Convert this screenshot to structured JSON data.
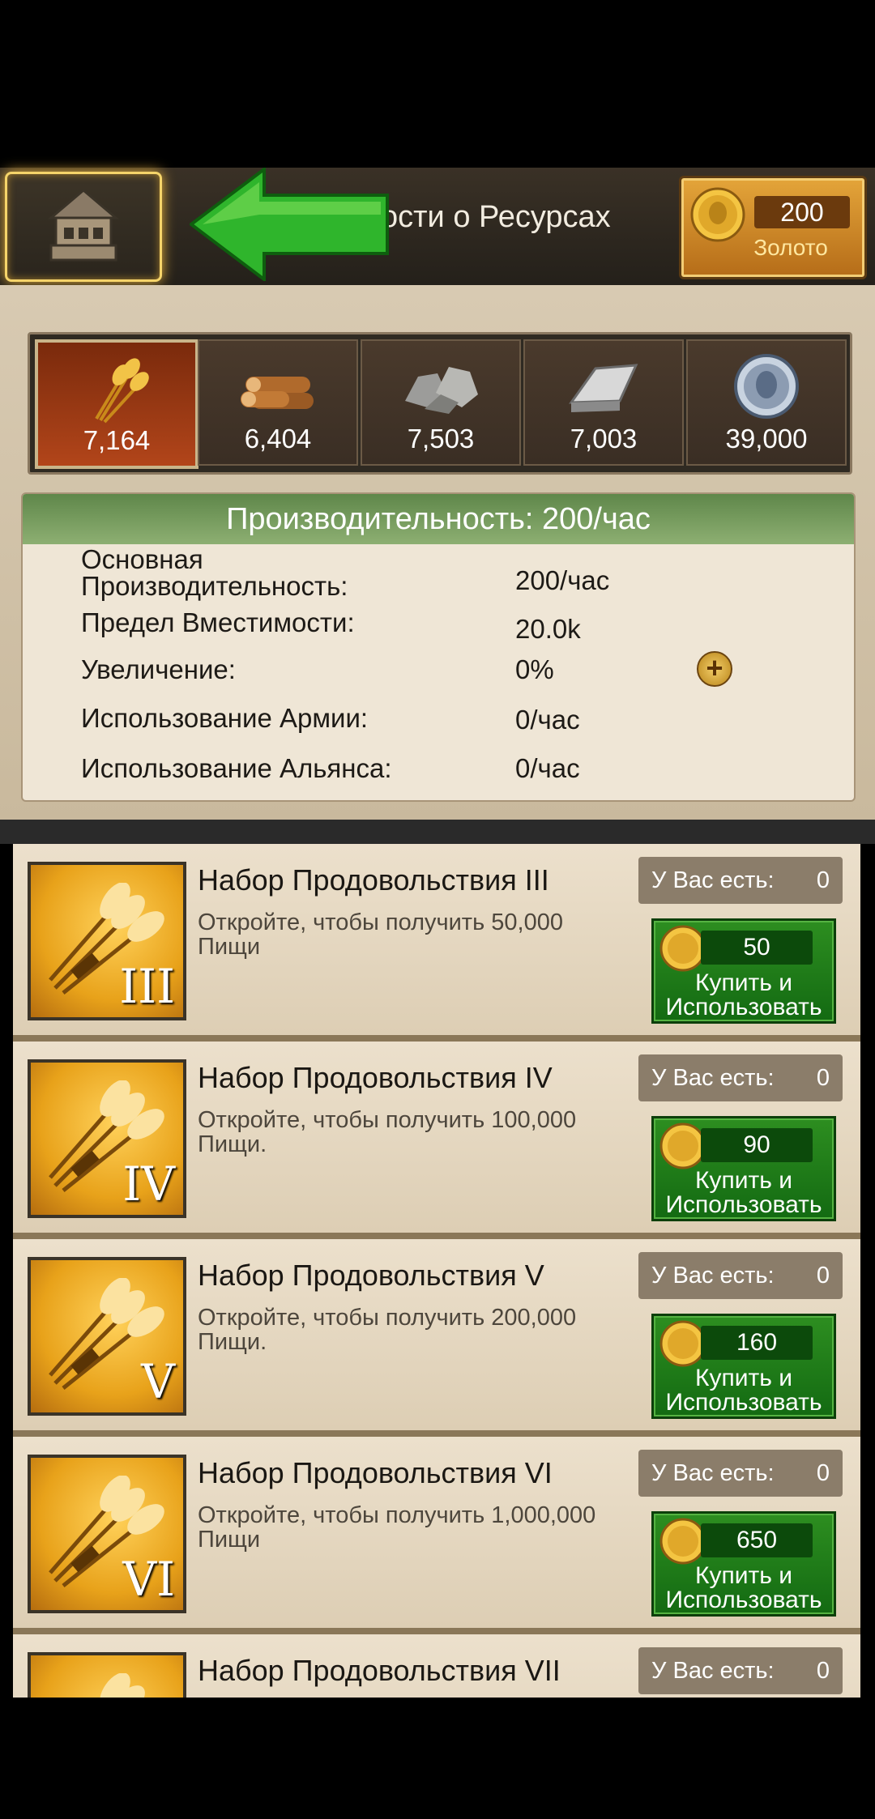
{
  "header": {
    "title": "ости о Ресурсах",
    "gold": {
      "amount": "200",
      "label": "Золото"
    }
  },
  "resources": [
    {
      "name": "food",
      "icon": "wheat-icon",
      "value": "7,164",
      "active": true
    },
    {
      "name": "wood",
      "icon": "logs-icon",
      "value": "6,404",
      "active": false
    },
    {
      "name": "stone",
      "icon": "stone-icon",
      "value": "7,503",
      "active": false
    },
    {
      "name": "iron",
      "icon": "iron-ingot-icon",
      "value": "7,003",
      "active": false
    },
    {
      "name": "silver",
      "icon": "silver-coin-icon",
      "value": "39,000",
      "active": false
    }
  ],
  "production": {
    "header": "Производительность: 200/час",
    "rows": [
      {
        "label": "Основная Производительность:",
        "value": "200/час"
      },
      {
        "label": "Предел Вместимости:",
        "value": "20.0k"
      },
      {
        "label": "Увеличение:",
        "value": "0%"
      },
      {
        "label": "Использование Армии:",
        "value": "0/час"
      },
      {
        "label": "Использование Альянса:",
        "value": "0/час"
      }
    ]
  },
  "items": [
    {
      "title": "Набор Продовольствия III",
      "desc": "Откройте, чтобы получить 50,000 Пищи",
      "roman": "III",
      "have_label": "У Вас есть:",
      "have": "0",
      "price": "50",
      "buy_label": "Купить и Использовать"
    },
    {
      "title": "Набор Продовольствия IV",
      "desc": "Откройте, чтобы получить 100,000 Пищи.",
      "roman": "IV",
      "have_label": "У Вас есть:",
      "have": "0",
      "price": "90",
      "buy_label": "Купить и Использовать"
    },
    {
      "title": "Набор Продовольствия V",
      "desc": "Откройте, чтобы получить 200,000 Пищи.",
      "roman": "V",
      "have_label": "У Вас есть:",
      "have": "0",
      "price": "160",
      "buy_label": "Купить и Использовать"
    },
    {
      "title": "Набор Продовольствия VI",
      "desc": "Откройте, чтобы получить 1,000,000 Пищи",
      "roman": "VI",
      "have_label": "У Вас есть:",
      "have": "0",
      "price": "650",
      "buy_label": "Купить и Использовать"
    },
    {
      "title": "Набор Продовольствия VII",
      "desc": "",
      "roman": "",
      "have_label": "У Вас есть:",
      "have": "0",
      "price": "",
      "buy_label": ""
    }
  ],
  "colors": {
    "accent_green": "#2d8e20",
    "gold": "#e4a53a",
    "active_resource": "#b2451a"
  }
}
